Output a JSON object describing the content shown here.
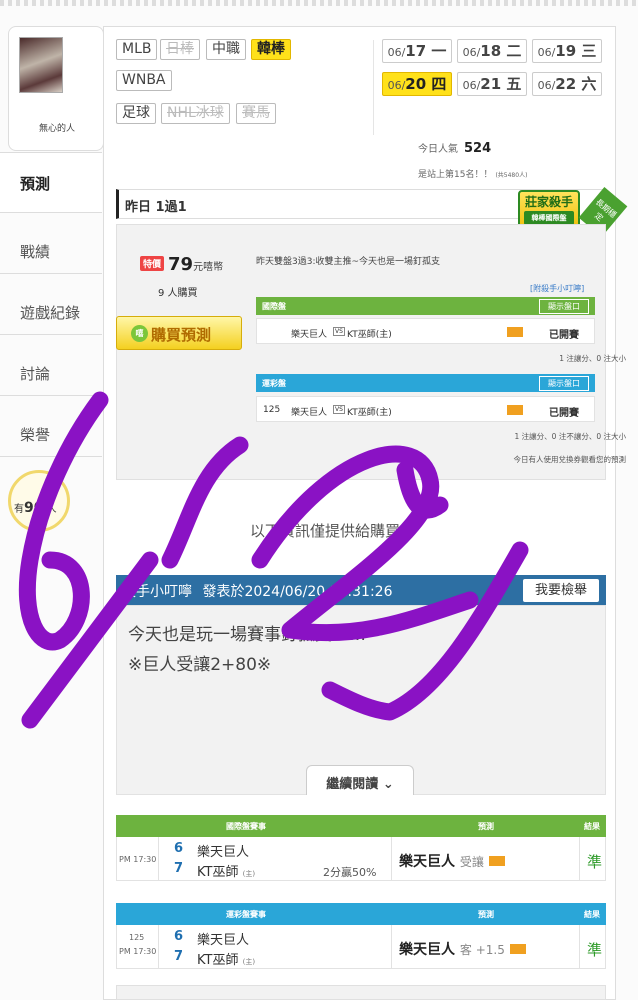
{
  "profile": {
    "username": "無心的人"
  },
  "nav": {
    "items": [
      "預測",
      "戰績",
      "遊戲紀錄",
      "討論",
      "榮譽"
    ]
  },
  "coin": {
    "prefix": "有",
    "count": "90",
    "suffix": "人"
  },
  "sports": {
    "row1": [
      "MLB",
      "日棒",
      "中職",
      "韓棒"
    ],
    "row2": [
      "WNBA"
    ],
    "row3": [
      "足球",
      "NHL冰球",
      "賽馬"
    ]
  },
  "dates": [
    {
      "md": "06/",
      "d": "17 一"
    },
    {
      "md": "06/",
      "d": "18 二"
    },
    {
      "md": "06/",
      "d": "19 三"
    },
    {
      "md": "06/",
      "d": "20 四"
    },
    {
      "md": "06/",
      "d": "21 五"
    },
    {
      "md": "06/",
      "d": "22 六"
    }
  ],
  "popularity": {
    "label": "今日人氣",
    "value": "524",
    "rank": "是站上第15名！！",
    "rank_small": "(共5480人)"
  },
  "yesterday": {
    "label": "昨日 1過1"
  },
  "badge": {
    "title": "莊家殺手",
    "sub": "韓棒國際盤",
    "ribbon": "長期穩定"
  },
  "prediction": {
    "special": "特價",
    "price": "79",
    "unit": "元嘻幣",
    "buyers": "9 人購買",
    "buy_button": "購買預測",
    "buy_icon": "嘻",
    "description": "昨天雙盤3過3:收雙主推~今天也是一場釘孤支",
    "tip_link": "[附殺手小叮嚀]",
    "intl": {
      "header": "國際盤",
      "show": "顯示盤口",
      "home": "樂天巨人",
      "away": "KT巫師(主)",
      "status": "已開賽",
      "note": "1 注讓分、0 注大小"
    },
    "sport_lottery": {
      "header": "運彩盤",
      "show": "顯示盤口",
      "no": "125",
      "home": "樂天巨人",
      "away": "KT巫師(主)",
      "status": "已開賽",
      "note": "1 注讓分、0 注不讓分、0 注大小"
    },
    "coupon_note": "今日有人使用兌換券觀看您的預測"
  },
  "notice": "以下資訊僅提供給購買者",
  "tip": {
    "title": "殺手小叮嚀",
    "datetime": "發表於2024/06/20 11:31:26",
    "report": "我要檢舉",
    "line1": "今天也是玩一場賽事釘孤支……",
    "line2": "※巨人受讓2+80※",
    "readmore": "繼續閱讀"
  },
  "results": [
    {
      "header": "國際盤賽事",
      "pred_header": "預測",
      "res_header": "結果",
      "no": "",
      "time": "PM 17:30",
      "n1": "6",
      "t1": "樂天巨人",
      "n2": "7",
      "t2": "KT巫師",
      "t2_tag": "(主)",
      "pct": "2分贏50%",
      "pred": "樂天巨人",
      "pred_type": "受讓",
      "result": "準"
    },
    {
      "header": "運彩盤賽事",
      "pred_header": "預測",
      "res_header": "結果",
      "no": "125",
      "time": "PM 17:30",
      "n1": "6",
      "t1": "樂天巨人",
      "n2": "7",
      "t2": "KT巫師",
      "t2_tag": "(主)",
      "pct": "",
      "pred": "樂天巨人",
      "pred_type": "客 +1.5",
      "result": "準"
    }
  ],
  "handwriting": {
    "text": "6/20 ✓",
    "color": "#8a12c4"
  },
  "colors": {
    "accent": "#ffe11a",
    "green": "#6db33f",
    "blue": "#2aa6d8",
    "tipbar": "#2d6fa3"
  }
}
